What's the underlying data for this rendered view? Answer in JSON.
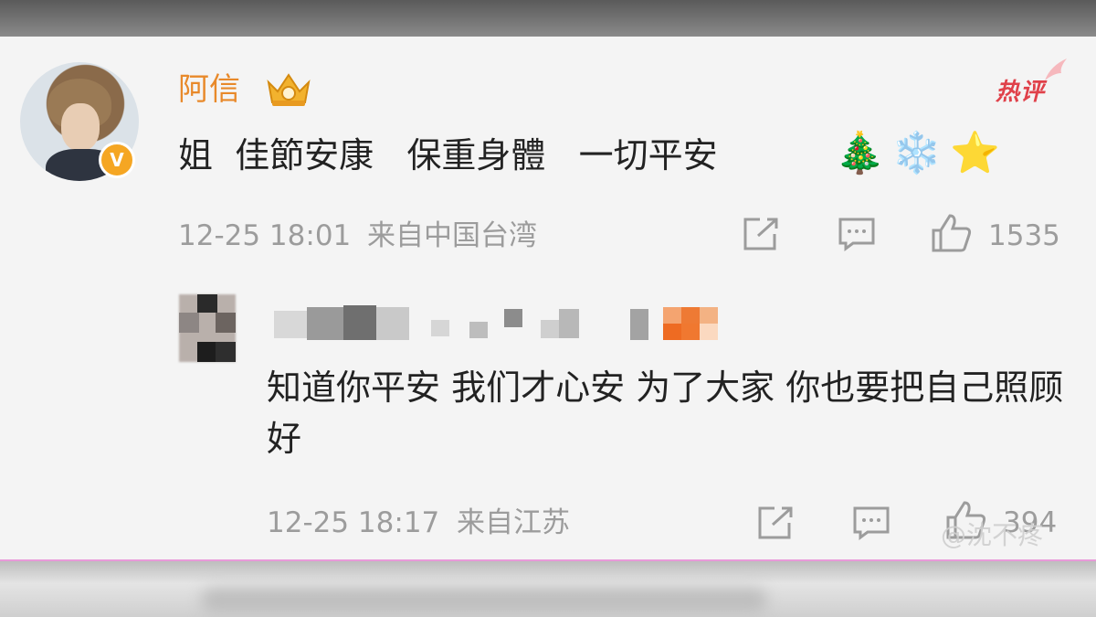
{
  "comment": {
    "username": "阿信",
    "hot_label": "热评",
    "text": "姐  佳節安康   保重身體   一切平安",
    "emojis": [
      "🎄",
      "❄️",
      "⭐"
    ],
    "timestamp": "12-25 18:01",
    "location": "来自中国台湾",
    "like_count": "1535"
  },
  "reply": {
    "text": "知道你平安 我们才心安 为了大家 你也要把自己照顾好",
    "timestamp": "12-25 18:17",
    "location": "来自江苏",
    "like_count": "394"
  },
  "watermark": "@沈不疼",
  "icons": {
    "share": "share-icon",
    "comment": "comment-icon",
    "like": "thumbs-up-icon",
    "verified": "verified-badge-icon",
    "crown": "crown-icon"
  },
  "colors": {
    "username": "#e8892a",
    "hot_badge": "#e0414a",
    "meta_text": "#9c9c9c",
    "background": "#f4f4f4"
  }
}
